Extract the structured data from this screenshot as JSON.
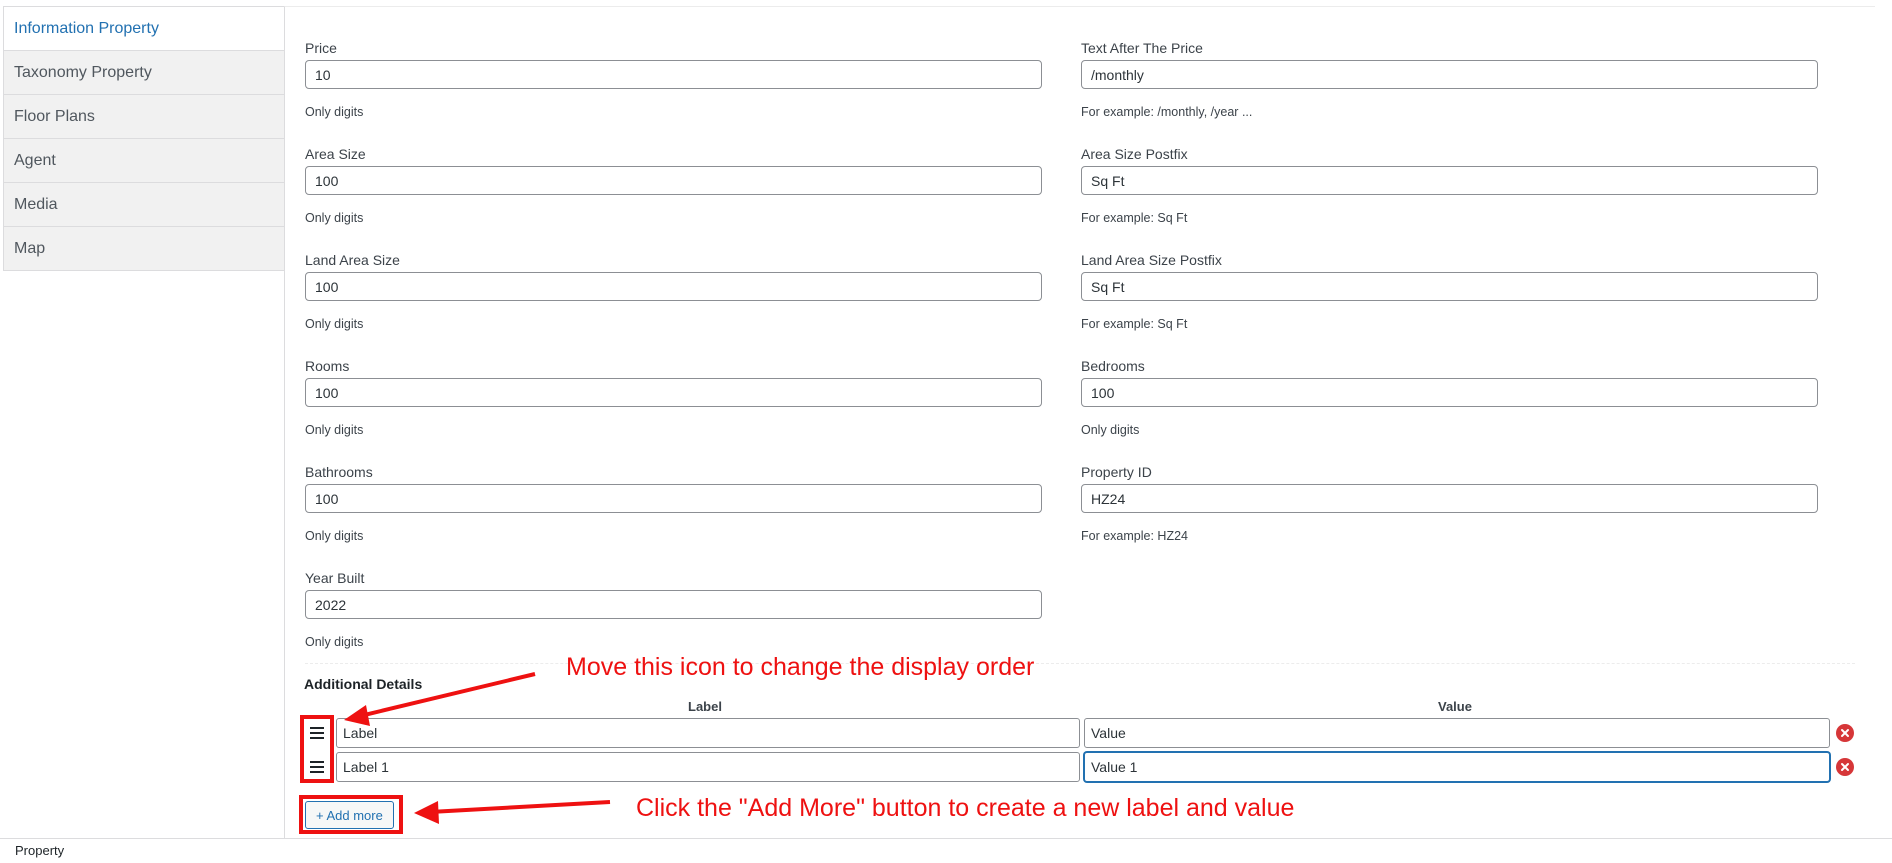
{
  "tabs": [
    {
      "label": "Information Property",
      "active": true
    },
    {
      "label": "Taxonomy Property",
      "active": false
    },
    {
      "label": "Floor Plans",
      "active": false
    },
    {
      "label": "Agent",
      "active": false
    },
    {
      "label": "Media",
      "active": false
    },
    {
      "label": "Map",
      "active": false
    }
  ],
  "fields": {
    "price": {
      "label": "Price",
      "value": "10",
      "help": "Only digits"
    },
    "text_after_price": {
      "label": "Text After The Price",
      "value": "/monthly",
      "help": "For example: /monthly, /year ..."
    },
    "area_size": {
      "label": "Area Size",
      "value": "100",
      "help": "Only digits"
    },
    "area_size_postfix": {
      "label": "Area Size Postfix",
      "value": "Sq Ft",
      "help": "For example: Sq Ft"
    },
    "land_area_size": {
      "label": "Land Area Size",
      "value": "100",
      "help": "Only digits"
    },
    "land_area_size_postfix": {
      "label": "Land Area Size Postfix",
      "value": "Sq Ft",
      "help": "For example: Sq Ft"
    },
    "rooms": {
      "label": "Rooms",
      "value": "100",
      "help": "Only digits"
    },
    "bedrooms": {
      "label": "Bedrooms",
      "value": "100",
      "help": "Only digits"
    },
    "bathrooms": {
      "label": "Bathrooms",
      "value": "100",
      "help": "Only digits"
    },
    "property_id": {
      "label": "Property ID",
      "value": "HZ24",
      "help": "For example: HZ24"
    },
    "year_built": {
      "label": "Year Built",
      "value": "2022",
      "help": "Only digits"
    }
  },
  "additional_details": {
    "title": "Additional Details",
    "label_header": "Label",
    "value_header": "Value",
    "rows": [
      {
        "label": "Label",
        "value": "Value"
      },
      {
        "label": "Label 1",
        "value": "Value 1"
      }
    ],
    "add_more_label": "+ Add more"
  },
  "annotations": {
    "drag_note": "Move this icon to change the display order",
    "add_note": "Click the \"Add More\" button to create a new label and value",
    "color": "#ee1111"
  },
  "footer": {
    "text": "Property"
  },
  "icons": {
    "drag": "drag-handle-icon",
    "remove": "remove-circle-icon"
  },
  "colors": {
    "accent": "#2271b1",
    "danger": "#d63638"
  }
}
